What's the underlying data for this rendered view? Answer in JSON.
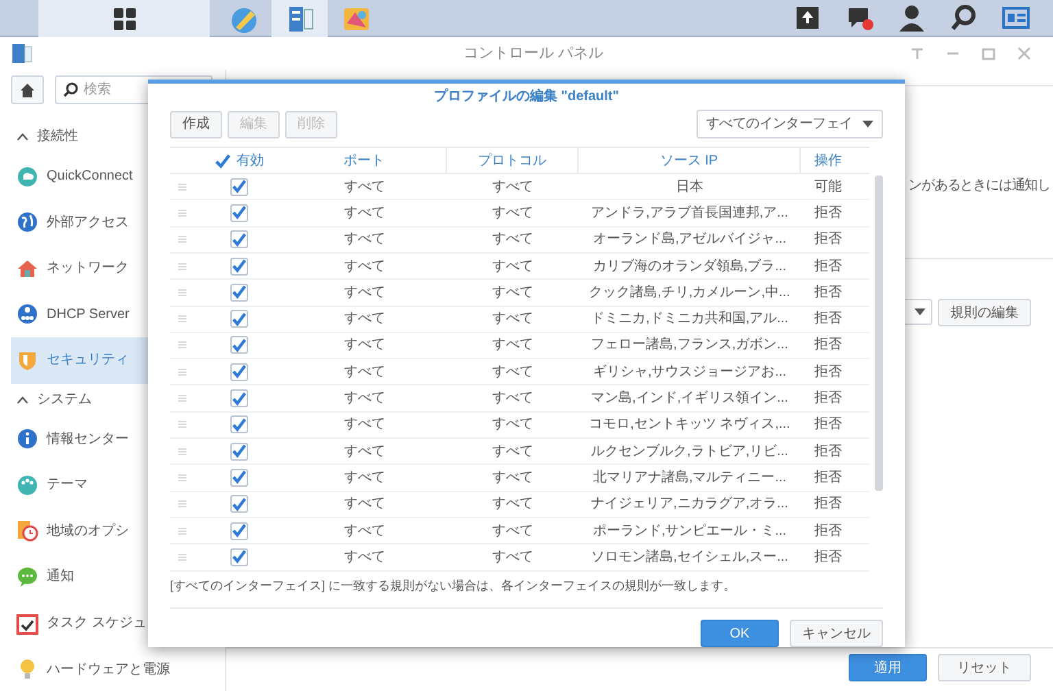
{
  "taskbar": {
    "apps": [
      {
        "kind": "menu",
        "selected": true
      },
      {
        "kind": "edit",
        "selected": false
      },
      {
        "kind": "panel",
        "selected": true
      },
      {
        "kind": "paint",
        "selected": false
      }
    ]
  },
  "window": {
    "title": "コントロール パネル"
  },
  "sidebar": {
    "search": {
      "placeholder": "検索"
    },
    "sections": [
      {
        "title": "接続性",
        "expanded": true,
        "items": [
          {
            "label": "QuickConnect",
            "kind": "cloud",
            "selected": false
          },
          {
            "label": "外部アクセス",
            "kind": "globe",
            "selected": false
          },
          {
            "label": "ネットワーク",
            "kind": "house",
            "selected": false
          },
          {
            "label": "DHCP Server",
            "kind": "dhcp",
            "selected": false
          },
          {
            "label": "セキュリティ",
            "kind": "shield",
            "selected": true
          }
        ]
      },
      {
        "title": "システム",
        "expanded": true,
        "items": [
          {
            "label": "情報センター",
            "kind": "info",
            "selected": false
          },
          {
            "label": "テーマ",
            "kind": "palette",
            "selected": false
          },
          {
            "label": "地域のオプシ",
            "kind": "clock",
            "selected": false
          },
          {
            "label": "通知",
            "kind": "chat",
            "selected": false
          },
          {
            "label": "タスク スケジュ",
            "kind": "calendar",
            "selected": false
          },
          {
            "label": "ハードウェアと電源",
            "kind": "bulb",
            "selected": false
          }
        ]
      }
    ]
  },
  "main": {
    "notice_fragment": "ンがあるときには通知し",
    "edit_rules_button": "規則の編集",
    "apply_button": "適用",
    "reset_button": "リセット"
  },
  "dialog": {
    "title": "プロファイルの編集 \"default\"",
    "toolbar": [
      {
        "label": "作成",
        "disabled": false
      },
      {
        "label": "編集",
        "disabled": true
      },
      {
        "label": "削除",
        "disabled": true
      }
    ],
    "interface_select": "すべてのインターフェイ",
    "columns": [
      {
        "label": "有効",
        "checked": true
      },
      {
        "label": "ポート"
      },
      {
        "label": "プロトコル"
      },
      {
        "label": "ソース IP"
      },
      {
        "label": "操作"
      }
    ],
    "rows": [
      {
        "enabled": true,
        "port": "すべて",
        "protocol": "すべて",
        "source": "日本",
        "action": "可能"
      },
      {
        "enabled": true,
        "port": "すべて",
        "protocol": "すべて",
        "source": "アンドラ,アラブ首長国連邦,ア...",
        "action": "拒否"
      },
      {
        "enabled": true,
        "port": "すべて",
        "protocol": "すべて",
        "source": "オーランド島,アゼルバイジャ...",
        "action": "拒否"
      },
      {
        "enabled": true,
        "port": "すべて",
        "protocol": "すべて",
        "source": "カリブ海のオランダ領島,ブラ...",
        "action": "拒否"
      },
      {
        "enabled": true,
        "port": "すべて",
        "protocol": "すべて",
        "source": "クック諸島,チリ,カメルーン,中...",
        "action": "拒否"
      },
      {
        "enabled": true,
        "port": "すべて",
        "protocol": "すべて",
        "source": "ドミニカ,ドミニカ共和国,アル...",
        "action": "拒否"
      },
      {
        "enabled": true,
        "port": "すべて",
        "protocol": "すべて",
        "source": "フェロー諸島,フランス,ガボン...",
        "action": "拒否"
      },
      {
        "enabled": true,
        "port": "すべて",
        "protocol": "すべて",
        "source": "ギリシャ,サウスジョージアお...",
        "action": "拒否"
      },
      {
        "enabled": true,
        "port": "すべて",
        "protocol": "すべて",
        "source": "マン島,インド,イギリス領イン...",
        "action": "拒否"
      },
      {
        "enabled": true,
        "port": "すべて",
        "protocol": "すべて",
        "source": "コモロ,セントキッツ ネヴィス,...",
        "action": "拒否"
      },
      {
        "enabled": true,
        "port": "すべて",
        "protocol": "すべて",
        "source": "ルクセンブルク,ラトビア,リビ...",
        "action": "拒否"
      },
      {
        "enabled": true,
        "port": "すべて",
        "protocol": "すべて",
        "source": "北マリアナ諸島,マルティニー...",
        "action": "拒否"
      },
      {
        "enabled": true,
        "port": "すべて",
        "protocol": "すべて",
        "source": "ナイジェリア,ニカラグア,オラ...",
        "action": "拒否"
      },
      {
        "enabled": true,
        "port": "すべて",
        "protocol": "すべて",
        "source": "ポーランド,サンピエール・ミ...",
        "action": "拒否"
      },
      {
        "enabled": true,
        "port": "すべて",
        "protocol": "すべて",
        "source": "ソロモン諸島,セイシェル,スー...",
        "action": "拒否"
      }
    ],
    "note": "[すべてのインターフェイス] に一致する規則がない場合は、各インターフェイスの規則が一致します。",
    "ok_button": "OK",
    "cancel_button": "キャンセル"
  }
}
